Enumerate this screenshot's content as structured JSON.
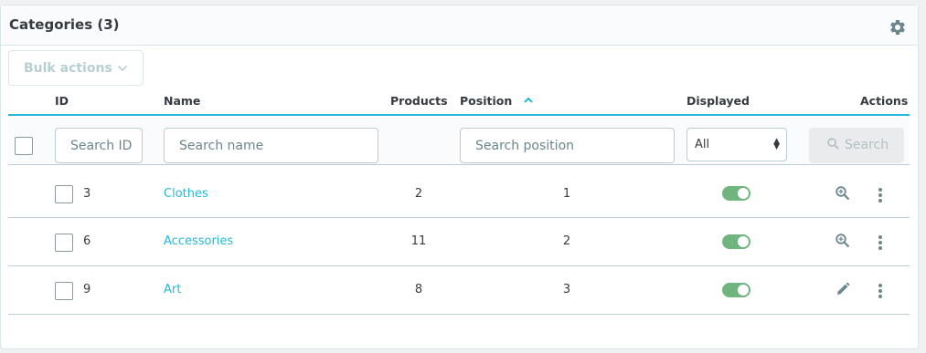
{
  "card": {
    "title": "Categories (3)"
  },
  "toolbar": {
    "settings_icon": "gear-icon"
  },
  "bulk": {
    "label": "Bulk actions"
  },
  "columns": {
    "id": "ID",
    "name": "Name",
    "products": "Products",
    "position": "Position",
    "displayed": "Displayed",
    "actions": "Actions"
  },
  "filters": {
    "id_placeholder": "Search ID",
    "name_placeholder": "Search name",
    "position_placeholder": "Search position",
    "displayed_value": "All",
    "search_label": "Search"
  },
  "rows": [
    {
      "id": "3",
      "name": "Clothes",
      "products": "2",
      "position": "1",
      "displayed": true,
      "action_icon": "zoom-in-icon"
    },
    {
      "id": "6",
      "name": "Accessories",
      "products": "11",
      "position": "2",
      "displayed": true,
      "action_icon": "zoom-in-icon"
    },
    {
      "id": "9",
      "name": "Art",
      "products": "8",
      "position": "3",
      "displayed": true,
      "action_icon": "pencil-icon"
    }
  ],
  "colors": {
    "accent": "#25b9d7",
    "toggle_on": "#70b580"
  }
}
